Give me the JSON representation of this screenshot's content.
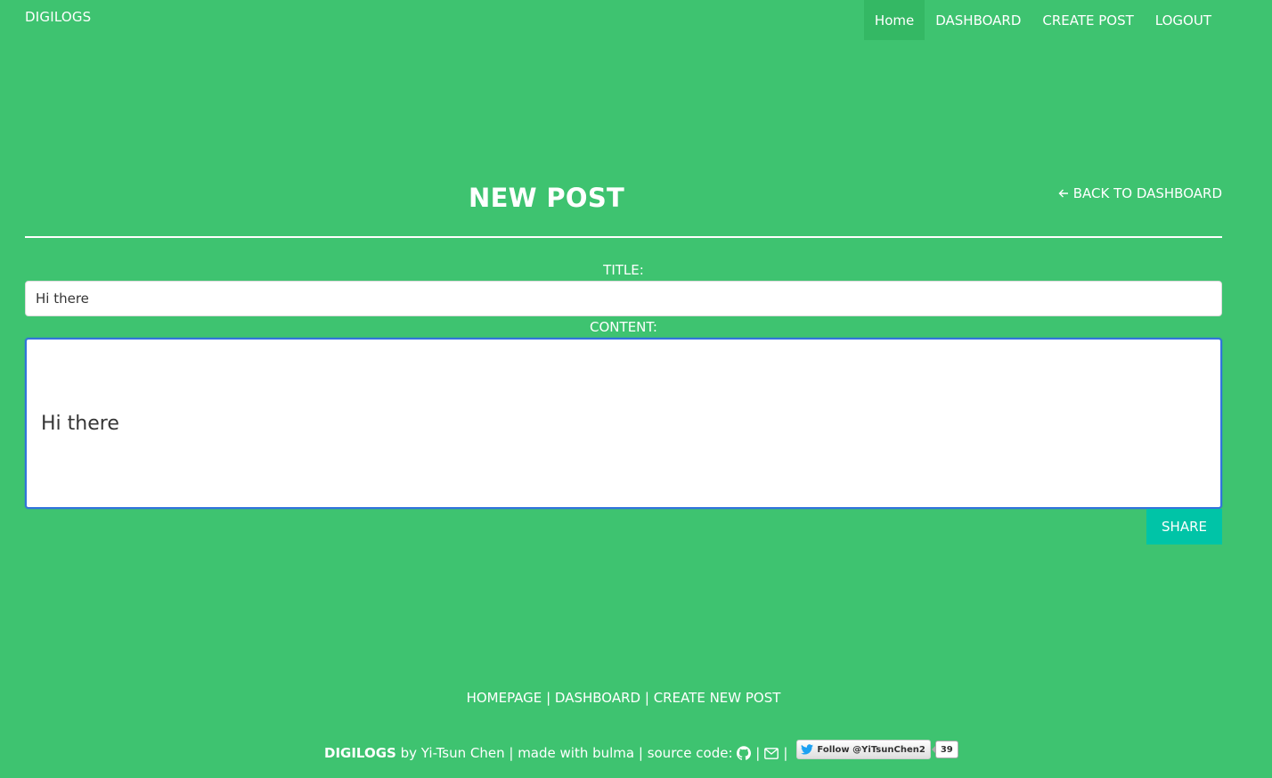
{
  "navbar": {
    "brand": "DIGILOGS",
    "items": [
      {
        "label": "Home",
        "active": true
      },
      {
        "label": "DASHBOARD",
        "active": false
      },
      {
        "label": "CREATE POST",
        "active": false
      },
      {
        "label": "LOGOUT",
        "active": false
      }
    ]
  },
  "page": {
    "title": "NEW POST",
    "back_link": "BACK TO DASHBOARD",
    "back_icon": "arrow-left-icon"
  },
  "form": {
    "title_label": "TITLE:",
    "title_value": "Hi there",
    "content_label": "CONTENT:",
    "content_value": "Hi there",
    "share_label": "SHARE"
  },
  "footer": {
    "links": [
      "HOMEPAGE",
      "DASHBOARD",
      "CREATE NEW POST"
    ],
    "separator": "|",
    "brand": "DIGILOGS",
    "credit": "by Yi-Tsun Chen | made with bulma | source code:",
    "twitter_label": "Follow @YiTsunChen2",
    "twitter_count": "39"
  },
  "colors": {
    "background": "#3ec370",
    "active_nav": "#34b864",
    "share_button": "#00c4a7",
    "focus_border": "#3273dc"
  }
}
